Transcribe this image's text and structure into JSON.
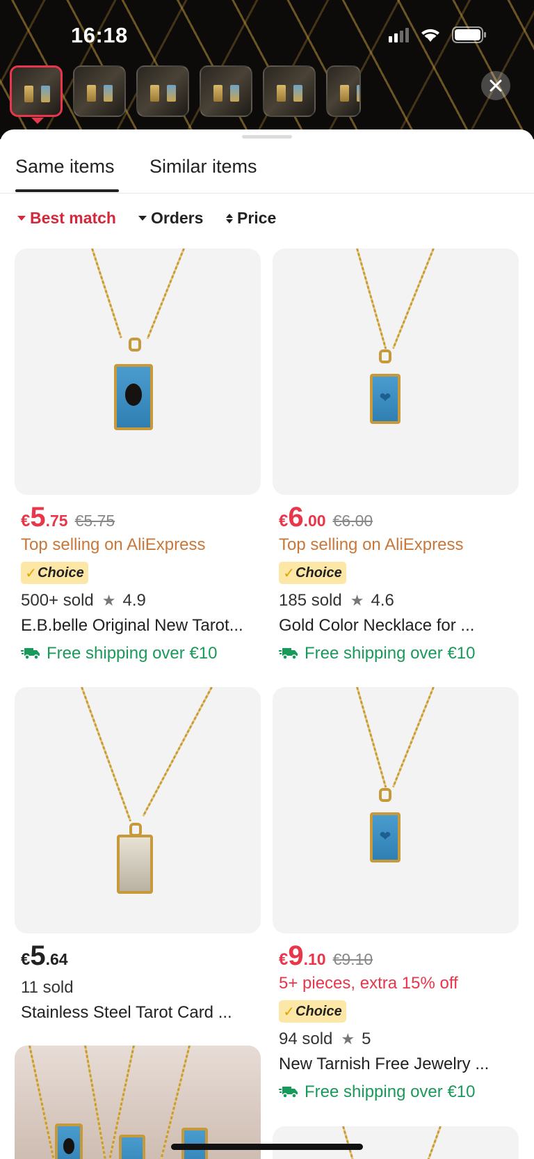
{
  "status": {
    "time": "16:18"
  },
  "tabs": {
    "same": "Same items",
    "similar": "Similar items"
  },
  "sort": {
    "best": "Best match",
    "orders": "Orders",
    "price": "Price"
  },
  "products": [
    {
      "currency": "€",
      "int": "5",
      "dec": ".75",
      "orig": "€5.75",
      "promo": "Top selling on AliExpress",
      "choice": "Choice",
      "sold": "500+ sold",
      "rating": "4.9",
      "title": "E.B.belle Original New Tarot...",
      "shipping": "Free shipping over €10"
    },
    {
      "currency": "€",
      "int": "6",
      "dec": ".00",
      "orig": "€6.00",
      "promo": "Top selling on AliExpress",
      "choice": "Choice",
      "sold": "185 sold",
      "rating": "4.6",
      "title": "Gold Color Necklace for ...",
      "shipping": "Free shipping over €10"
    },
    {
      "currency": "€",
      "int": "5",
      "dec": ".64",
      "sold": "11 sold",
      "title": "Stainless Steel Tarot Card ..."
    },
    {
      "currency": "€",
      "int": "9",
      "dec": ".10",
      "orig": "€9.10",
      "promo": "5+ pieces, extra 15% off",
      "choice": "Choice",
      "sold": "94 sold",
      "rating": "5",
      "title": "New Tarnish Free Jewelry ...",
      "shipping": "Free shipping over €10"
    }
  ],
  "colors": {
    "accent": "#e8364a",
    "promo": "#c8783a",
    "shipping": "#1a9a5a",
    "choice_bg": "#fde7a6"
  },
  "icons": [
    "close-icon",
    "star-icon",
    "truck-icon",
    "wifi-icon",
    "battery-icon",
    "signal-icon",
    "caret-down-icon",
    "sort-updown-icon"
  ]
}
